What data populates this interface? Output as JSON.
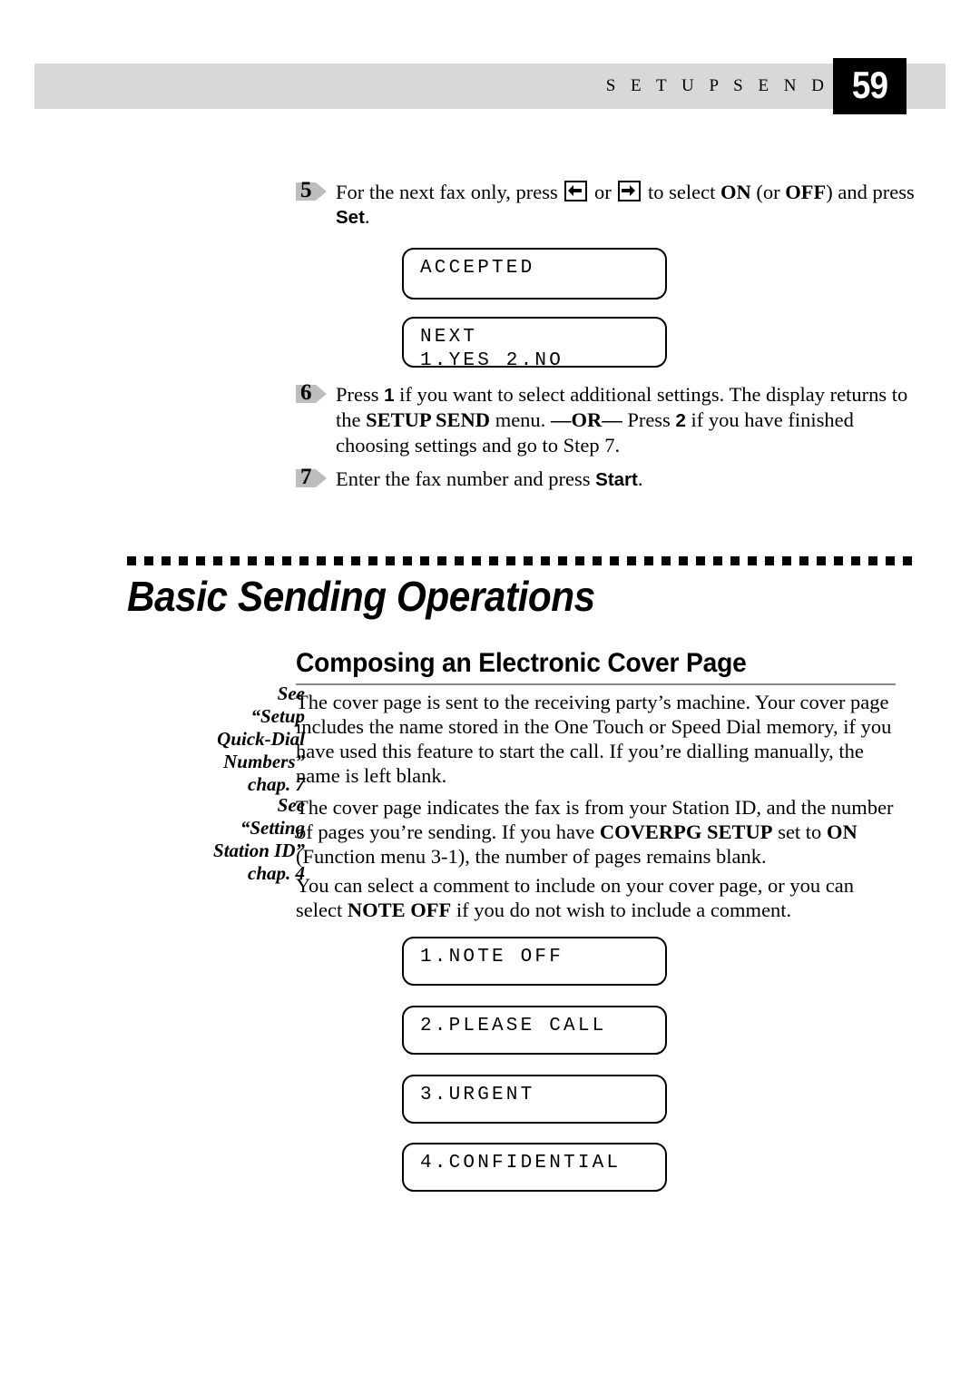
{
  "header": {
    "running_head": "S E T U P   S E N D",
    "page_number": "59",
    "band_color": "#d8d8d8",
    "page_box_color": "#000000"
  },
  "steps": [
    {
      "number": "5",
      "segments": [
        {
          "text": "For the next fax only, press ",
          "style": "normal"
        },
        {
          "text": "left-arrow-key",
          "style": "keycap"
        },
        {
          "text": " or ",
          "style": "normal"
        },
        {
          "text": "right-arrow-key",
          "style": "keycap"
        },
        {
          "text": " to select ",
          "style": "normal"
        },
        {
          "text": "ON",
          "style": "bold"
        },
        {
          "text": " (or ",
          "style": "normal"
        },
        {
          "text": "OFF",
          "style": "bold"
        },
        {
          "text": ") and press ",
          "style": "normal"
        },
        {
          "text": "Set",
          "style": "sans-bold"
        },
        {
          "text": ".",
          "style": "normal"
        }
      ]
    },
    {
      "number": "6",
      "segments": [
        {
          "text": "Press ",
          "style": "normal"
        },
        {
          "text": "1",
          "style": "sans-bold"
        },
        {
          "text": " if you want to select additional settings. The display returns to the ",
          "style": "normal"
        },
        {
          "text": "SETUP SEND",
          "style": "bold"
        },
        {
          "text": " menu. ",
          "style": "normal"
        },
        {
          "text": "—OR—",
          "style": "bold"
        },
        {
          "text": " Press ",
          "style": "normal"
        },
        {
          "text": "2",
          "style": "sans-bold"
        },
        {
          "text": " if you have finished choosing settings and go to Step 7.",
          "style": "normal"
        }
      ]
    },
    {
      "number": "7",
      "segments": [
        {
          "text": "Enter the fax number and press ",
          "style": "normal"
        },
        {
          "text": "Start",
          "style": "sans-bold"
        },
        {
          "text": ".",
          "style": "normal"
        }
      ]
    }
  ],
  "lcd_displays": {
    "accepted": {
      "line1": "ACCEPTED",
      "line2": ""
    },
    "next": {
      "line1": "NEXT",
      "line2": "1.YES 2.NO"
    },
    "note_off": {
      "line1": "1.NOTE OFF",
      "line2": ""
    },
    "please_call": {
      "line1": "2.PLEASE CALL",
      "line2": ""
    },
    "urgent": {
      "line1": "3.URGENT",
      "line2": ""
    },
    "confidential": {
      "line1": "4.CONFIDENTIAL",
      "line2": ""
    }
  },
  "chapter": {
    "title": "Basic Sending Operations"
  },
  "section": {
    "heading": "Composing an Electronic Cover Page"
  },
  "margin_notes": [
    {
      "lines": [
        "See",
        "“Setup",
        "Quick-Dial",
        "Numbers”",
        "chap. 7"
      ]
    },
    {
      "lines": [
        "See",
        "“Setting",
        "Station ID”",
        "chap. 4"
      ]
    }
  ],
  "paragraphs": [
    {
      "segments": [
        {
          "text": "The cover page is sent to the receiving party’s machine. Your cover page includes the name stored in the One Touch or Speed Dial memory, if you have used this feature to start the call. If you’re dialling manually, the name is left blank.",
          "style": "normal"
        }
      ]
    },
    {
      "segments": [
        {
          "text": "The cover page indicates the fax is from your Station ID, and the number of pages you’re sending. If you have ",
          "style": "normal"
        },
        {
          "text": "COVERPG SETUP",
          "style": "bold"
        },
        {
          "text": " set to ",
          "style": "normal"
        },
        {
          "text": "ON",
          "style": "bold"
        },
        {
          "text": " (Function menu 3-1), the number of pages remains blank.",
          "style": "normal"
        }
      ]
    },
    {
      "segments": [
        {
          "text": "You can select a comment to include on your cover page, or you can select ",
          "style": "normal"
        },
        {
          "text": "NOTE OFF",
          "style": "bold"
        },
        {
          "text": " if you do not wish to include a comment.",
          "style": "normal"
        }
      ]
    }
  ],
  "dotted_rule": {
    "square_count": 46
  }
}
